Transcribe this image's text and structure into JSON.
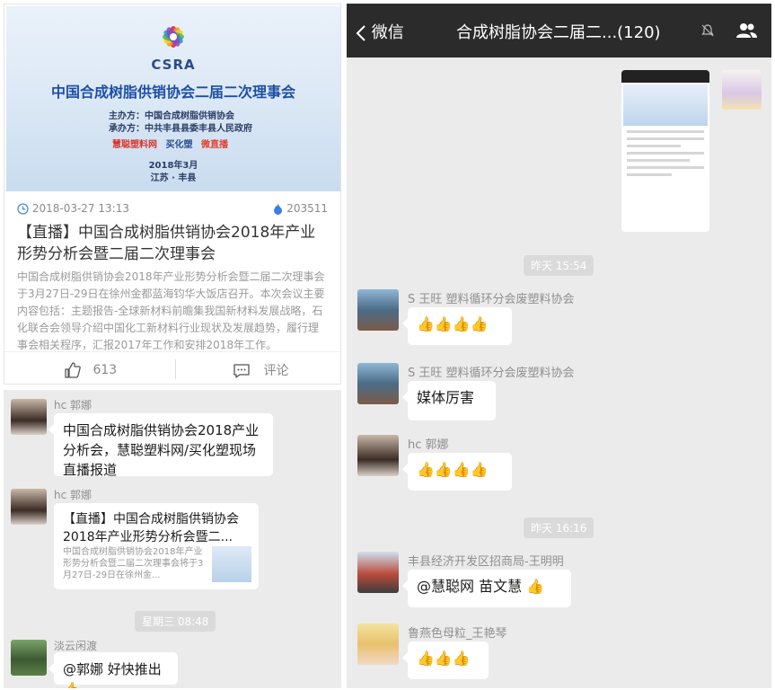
{
  "article": {
    "banner": {
      "brand": "CSRA",
      "title": "中国合成树脂供销协会二届二次理事会",
      "organizer": "主办方：中国合成树脂供销协会",
      "host": "承办方：中共丰县县委丰县人民政府",
      "logos": [
        "慧聪塑料网",
        "买化塑",
        "微直播"
      ],
      "date": "2018年3月",
      "location": "江苏 · 丰县"
    },
    "datetime": "2018-03-27 13:13",
    "views": "203511",
    "title": "【直播】中国合成树脂供销协会2018年产业形势分析会暨二届二次理事会",
    "summary": "中国合成树脂供销协会2018年产业形势分析会暨二届二次理事会于3月27日-29日在徐州金都蓝海钧华大饭店召开。本次会议主要内容包括：主题报告-全球新材料前瞻集我国新材料发展战略，石化联合会领导介绍中国化工新材料行业现状及发展趋势，履行理事会相关程序，汇报2017年工作和安排2018年工作。",
    "like_count": "613",
    "comment_label": "评论"
  },
  "chat_left": {
    "messages": [
      {
        "sender": "hc 郭娜",
        "text": "中国合成树脂供销协会2018产业分析会，慧聪塑料网/买化塑现场直播报道"
      },
      {
        "sender": "hc 郭娜",
        "link_title": "【直播】中国合成树脂供销协会2018年产业形势分析会暨二...",
        "link_desc": "中国合成树脂供销协会2018年产业形势分析会暨二届二次理事会将于3月27日-29日在徐州金..."
      }
    ],
    "time_divider": "星期三 08:48",
    "reply": {
      "sender": "淡云闲渡",
      "text": "@郭娜 好快推出👍"
    }
  },
  "chat_right": {
    "header": {
      "back_label": "微信",
      "title": "合成树脂协会二届二...(120)"
    },
    "time1": "昨天 15:54",
    "time2": "昨天 16:16",
    "messages": [
      {
        "sender": "S 王旺 塑料循环分会废塑料协会",
        "text": "👍👍👍👍"
      },
      {
        "sender": "S 王旺 塑料循环分会废塑料协会",
        "text": "媒体厉害"
      },
      {
        "sender": "hc 郭娜",
        "text": "👍👍👍👍"
      },
      {
        "sender": "丰县经济开发区招商局-王明明",
        "text": "@慧聪网 苗文慧 👍"
      },
      {
        "sender": "鲁燕色母粒_王艳琴",
        "text": "👍👍👍"
      }
    ]
  },
  "colors": {
    "header_bg": "#2b2b2b",
    "chat_bg": "#ebebeb",
    "bubble_bg": "#ffffff",
    "brand_blue": "#1d4fa6"
  }
}
